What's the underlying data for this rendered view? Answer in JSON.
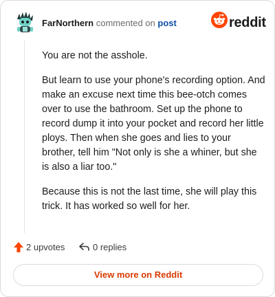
{
  "header": {
    "author": "FarNorthern",
    "action_text": "commented on",
    "post_link": "post",
    "brand": "reddit"
  },
  "comment": {
    "paragraphs": [
      "You are not the asshole.",
      "But learn to use your phone's recording option. And make an excuse next time this bee-otch comes over to use the bathroom. Set up the phone to record dump it into your pocket and record her little ploys. Then when she goes and lies to your brother, tell him \"Not only is she a whiner, but she is also a liar too.\"",
      "Because this is not the last time, she will play this trick. It has worked so well for her."
    ]
  },
  "actions": {
    "upvotes": "2 upvotes",
    "replies": "0 replies"
  },
  "footer": {
    "view_more": "View more on Reddit"
  },
  "colors": {
    "upvote_icon": "#ff4500",
    "brand_orange": "#ff4500",
    "link_blue": "#0d4fa8",
    "view_more": "#d93a00"
  },
  "icons": {
    "avatar": "snoo-avatar-icon",
    "brand": "reddit-logo-icon",
    "upvote": "upvote-arrow-icon",
    "reply": "reply-arrow-icon"
  }
}
